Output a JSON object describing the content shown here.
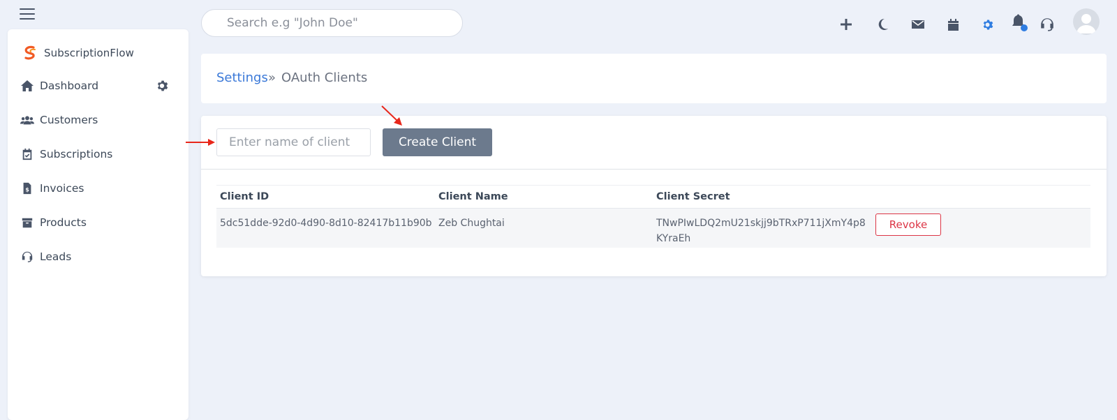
{
  "app": {
    "name": "SubscriptionFlow"
  },
  "search": {
    "placeholder": "Search e.g \"John Doe\""
  },
  "sidebar": {
    "items": [
      {
        "label": "Dashboard",
        "icon": "home-icon"
      },
      {
        "label": "Customers",
        "icon": "users-icon"
      },
      {
        "label": "Subscriptions",
        "icon": "calendar-check-icon"
      },
      {
        "label": "Invoices",
        "icon": "invoice-icon"
      },
      {
        "label": "Products",
        "icon": "archive-icon"
      },
      {
        "label": "Leads",
        "icon": "headset-icon"
      }
    ]
  },
  "topbar": {
    "icons": [
      "plus-icon",
      "moon-icon",
      "mail-icon",
      "calendar-icon",
      "gear-icon",
      "bell-icon",
      "headset-icon",
      "avatar"
    ]
  },
  "breadcrumb": {
    "link": "Settings",
    "separator": "»",
    "current": "OAuth Clients"
  },
  "form": {
    "input_placeholder": "Enter name of client",
    "button_label": "Create Client"
  },
  "table": {
    "headers": [
      "Client ID",
      "Client Name",
      "Client Secret"
    ],
    "rows": [
      {
        "client_id": "5dc51dde-92d0-4d90-8d10-82417b11b90b",
        "client_name": "Zeb Chughtai",
        "client_secret_line1": "TNwPIwLDQ2mU21skjj9bTRxP711jXmY4p8",
        "client_secret_line2": "KYraEh",
        "action": "Revoke"
      }
    ]
  },
  "colors": {
    "accent": "#3b79d8",
    "button": "#6c7a8d",
    "danger": "#dc3545",
    "annotation": "#e8271b",
    "brand": "#f15a24"
  }
}
